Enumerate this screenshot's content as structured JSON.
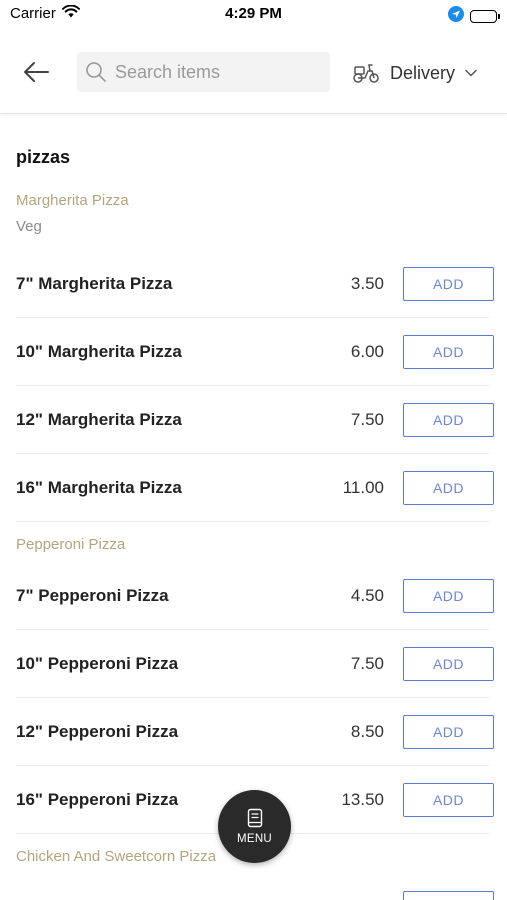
{
  "status_bar": {
    "carrier": "Carrier",
    "time": "4:29 PM"
  },
  "header": {
    "search_placeholder": "Search items",
    "delivery_label": "Delivery"
  },
  "menu": {
    "category": "pizzas",
    "groups": [
      {
        "title": "Margherita Pizza",
        "tag": "Veg"
      },
      {
        "title": "Pepperoni Pizza"
      },
      {
        "title": "Chicken And Sweetcorn Pizza"
      }
    ],
    "items": [
      {
        "name": "7\" Margherita Pizza",
        "price": "3.50",
        "action": "ADD"
      },
      {
        "name": "10\" Margherita Pizza",
        "price": "6.00",
        "action": "ADD"
      },
      {
        "name": "12\" Margherita Pizza",
        "price": "7.50",
        "action": "ADD"
      },
      {
        "name": "16\" Margherita Pizza",
        "price": "11.00",
        "action": "ADD"
      },
      {
        "name": "7\" Pepperoni Pizza",
        "price": "4.50",
        "action": "ADD"
      },
      {
        "name": "10\" Pepperoni Pizza",
        "price": "7.50",
        "action": "ADD"
      },
      {
        "name": "12\" Pepperoni Pizza",
        "price": "8.50",
        "action": "ADD"
      },
      {
        "name": "16\" Pepperoni Pizza",
        "price": "13.50",
        "action": "ADD"
      }
    ]
  },
  "fab": {
    "label": "MENU"
  },
  "colors": {
    "accent": "#5d7ad6",
    "subheading": "#b3a57c",
    "fab": "#2a2a2a"
  }
}
